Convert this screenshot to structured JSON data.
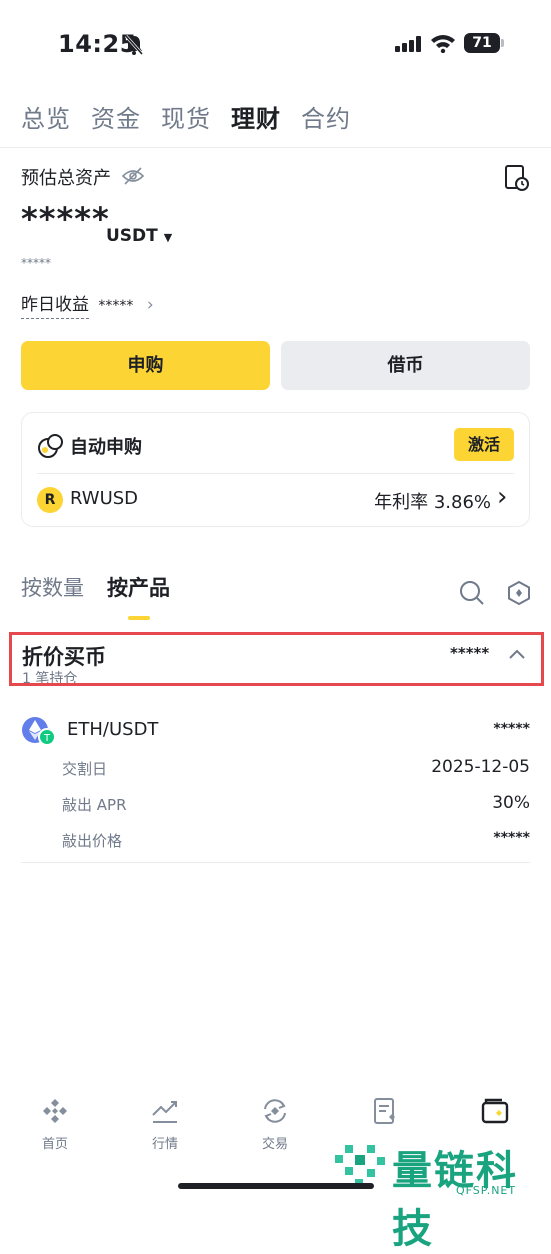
{
  "status": {
    "time": "14:25",
    "battery": "71"
  },
  "top_tabs": [
    "总览",
    "资金",
    "现货",
    "理财",
    "合约"
  ],
  "assets": {
    "title": "预估总资产",
    "amount": "*****",
    "currency": "USDT",
    "sub_amount": "*****",
    "yesterday_label": "昨日收益",
    "yesterday_value": "*****"
  },
  "actions": {
    "subscribe": "申购",
    "borrow": "借币"
  },
  "auto_card": {
    "title": "自动申购",
    "activate": "激活",
    "coin": "RWUSD",
    "apr_text": "年利率 3.86%"
  },
  "section_tabs": {
    "by_quantity": "按数量",
    "by_product": "按产品"
  },
  "discount": {
    "title": "折价买币",
    "value": "*****",
    "count": "1 笔持仓"
  },
  "holding": {
    "pair": "ETH/USDT",
    "value": "*****",
    "rows": [
      {
        "label": "交割日",
        "value": "2025-12-05"
      },
      {
        "label": "敲出 APR",
        "value": "30%"
      },
      {
        "label": "敲出价格",
        "value": "*****"
      }
    ]
  },
  "bottom_nav": [
    "首页",
    "行情",
    "交易",
    "",
    ""
  ],
  "watermark": {
    "text": "量链科技",
    "sub": "QFSP.NET"
  },
  "colors": {
    "accent": "#fcd535",
    "highlight_border": "#e5484d",
    "text": "#1e2026",
    "muted": "#707a8a"
  }
}
